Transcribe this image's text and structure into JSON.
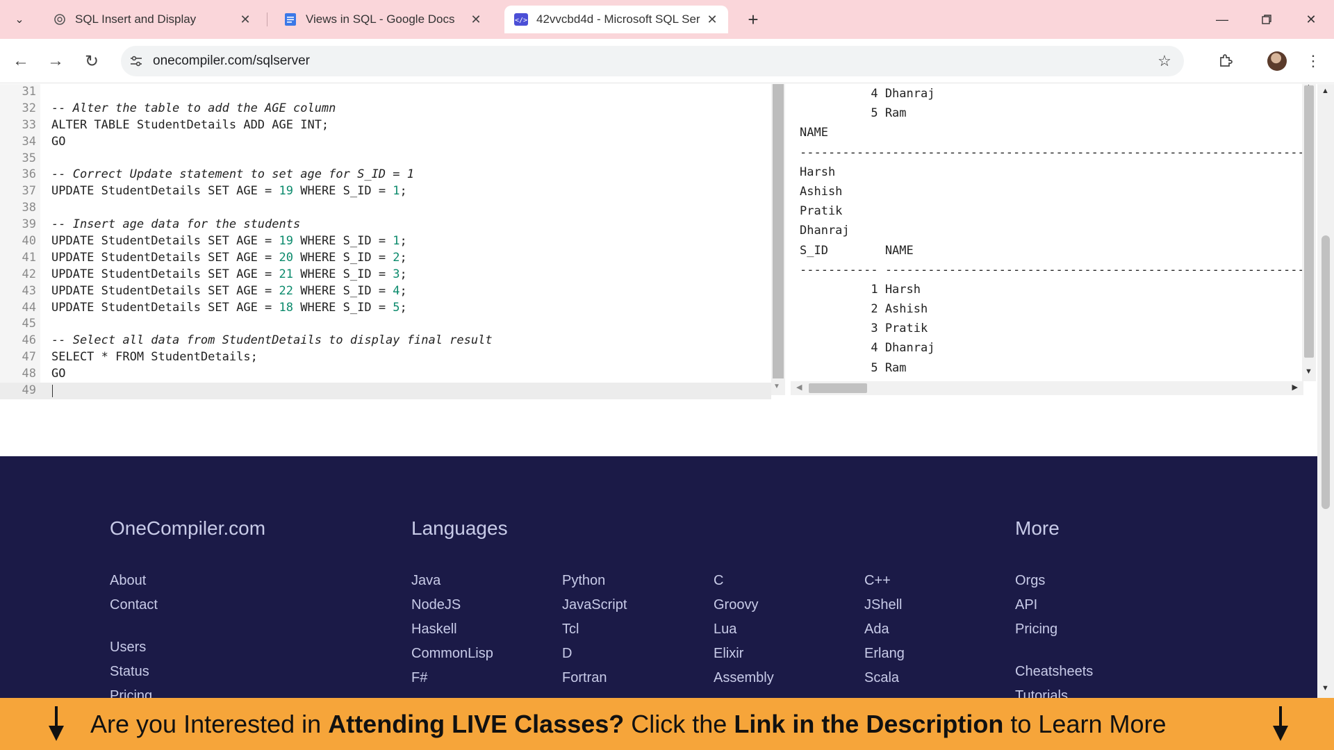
{
  "browser": {
    "tabs": [
      {
        "title": "SQL Insert and Display",
        "icon": "openai-icon"
      },
      {
        "title": "Views in SQL - Google Docs",
        "icon": "docs-icon"
      },
      {
        "title": "42vvcbd4d - Microsoft SQL Ser",
        "icon": "code-icon"
      }
    ],
    "url": "onecompiler.com/sqlserver"
  },
  "editor": {
    "lines": [
      {
        "n": "31",
        "t": ""
      },
      {
        "n": "32",
        "t": "-- Alter the table to add the AGE column"
      },
      {
        "n": "33",
        "t": "ALTER TABLE StudentDetails ADD AGE INT;"
      },
      {
        "n": "34",
        "t": "GO"
      },
      {
        "n": "35",
        "t": ""
      },
      {
        "n": "36",
        "t": "-- Correct Update statement to set age for S_ID = 1"
      },
      {
        "n": "37",
        "t": "UPDATE StudentDetails SET AGE = 19 WHERE S_ID = 1;"
      },
      {
        "n": "38",
        "t": ""
      },
      {
        "n": "39",
        "t": "-- Insert age data for the students"
      },
      {
        "n": "40",
        "t": "UPDATE StudentDetails SET AGE = 19 WHERE S_ID = 1;"
      },
      {
        "n": "41",
        "t": "UPDATE StudentDetails SET AGE = 20 WHERE S_ID = 2;"
      },
      {
        "n": "42",
        "t": "UPDATE StudentDetails SET AGE = 21 WHERE S_ID = 3;"
      },
      {
        "n": "43",
        "t": "UPDATE StudentDetails SET AGE = 22 WHERE S_ID = 4;"
      },
      {
        "n": "44",
        "t": "UPDATE StudentDetails SET AGE = 18 WHERE S_ID = 5;"
      },
      {
        "n": "45",
        "t": ""
      },
      {
        "n": "46",
        "t": "-- Select all data from StudentDetails to display final result"
      },
      {
        "n": "47",
        "t": "SELECT * FROM StudentDetails;"
      },
      {
        "n": "48",
        "t": "GO"
      },
      {
        "n": "49",
        "t": ""
      }
    ]
  },
  "output": {
    "lines": [
      "          4 Dhanraj",
      "          5 Ram",
      "NAME",
      "----------------------------------------------------------------------------------------------------",
      "Harsh",
      "Ashish",
      "Pratik",
      "Dhanraj",
      "S_ID        NAME",
      "----------- ----------------------------------------------------------------------------------------",
      "          1 Harsh",
      "          2 Ashish",
      "          3 Pratik",
      "          4 Dhanraj",
      "          5 Ram"
    ]
  },
  "footer": {
    "brand": "OneCompiler.com",
    "brand_links": [
      "About",
      "Contact",
      "Users",
      "Status",
      "Pricing"
    ],
    "languages_heading": "Languages",
    "languages": [
      [
        "Java",
        "NodeJS",
        "Haskell",
        "CommonLisp",
        "F#"
      ],
      [
        "Python",
        "JavaScript",
        "Tcl",
        "D",
        "Fortran"
      ],
      [
        "C",
        "Groovy",
        "Lua",
        "Elixir",
        "Assembly"
      ],
      [
        "C++",
        "JShell",
        "Ada",
        "Erlang",
        "Scala"
      ]
    ],
    "more_heading": "More",
    "more_links": [
      "Orgs",
      "API",
      "Pricing",
      "Cheatsheets",
      "Tutorials"
    ]
  },
  "banner": {
    "part1": "Are you Interested in ",
    "bold1": "Attending LIVE Classes?",
    "part2": " Click the ",
    "bold2": "Link in the Description",
    "part3": " to Learn More"
  },
  "colors": {
    "tabbar": "#fad6da",
    "footer_bg": "#1b1a47",
    "banner_bg": "#f6a53a",
    "number": "#0b8a6c",
    "comment": "#8a8a8a"
  }
}
